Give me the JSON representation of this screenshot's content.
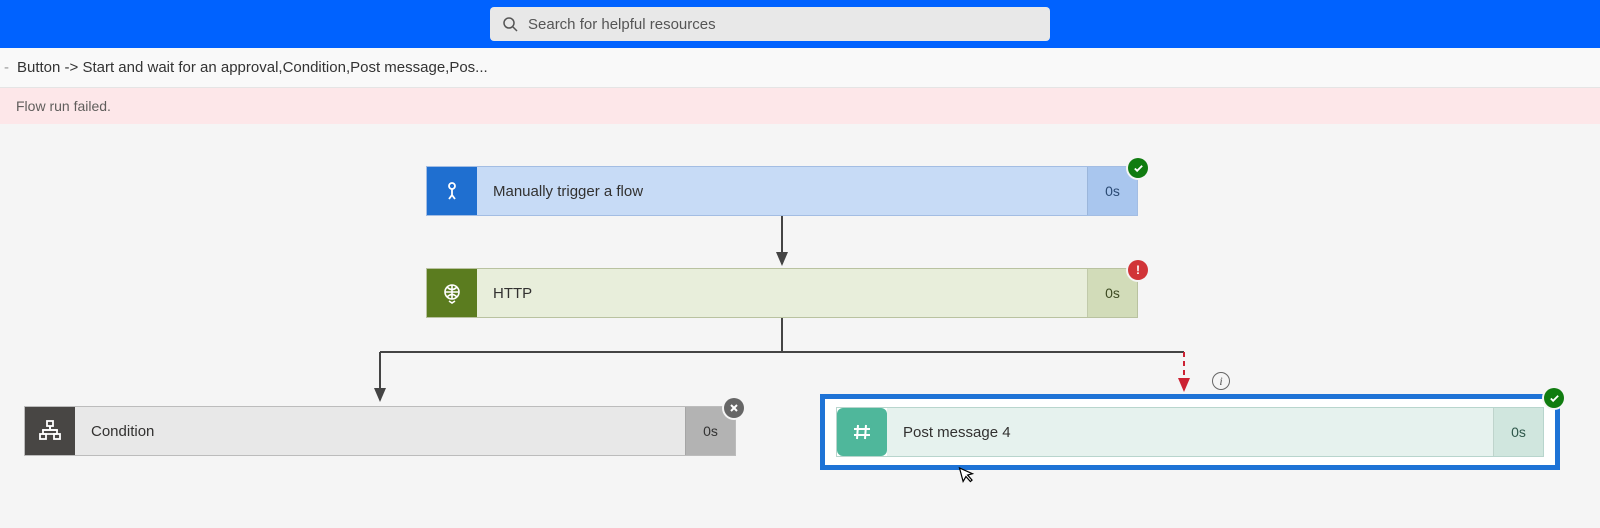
{
  "search": {
    "placeholder": "Search for helpful resources"
  },
  "breadcrumb": {
    "dash": "-",
    "text": "Button -> Start and wait for an approval,Condition,Post message,Pos..."
  },
  "error": {
    "text": "Flow run failed."
  },
  "cards": {
    "trigger": {
      "label": "Manually trigger a flow",
      "duration": "0s",
      "status": "ok"
    },
    "http": {
      "label": "HTTP",
      "duration": "0s",
      "status": "err"
    },
    "cond": {
      "label": "Condition",
      "duration": "0s",
      "status": "cancel"
    },
    "post": {
      "label": "Post message 4",
      "duration": "0s",
      "status": "ok"
    }
  },
  "icons": {
    "trigger": "touch-icon",
    "http": "globe-icon",
    "cond": "condition-icon",
    "post": "hash-icon"
  }
}
